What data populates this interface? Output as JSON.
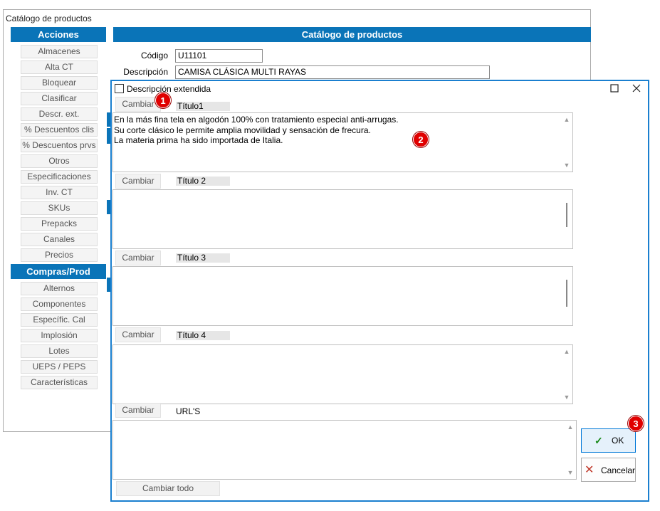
{
  "background_window": {
    "title": "Catálogo de productos",
    "acciones_header": "Acciones",
    "acciones": [
      "Almacenes",
      "Alta CT",
      "Bloquear",
      "Clasificar",
      "Descr. ext.",
      "% Descuentos clis",
      "% Descuentos prvs",
      "Otros",
      "Especificaciones",
      "Inv. CT",
      "SKUs",
      "Prepacks",
      "Canales",
      "Precios"
    ],
    "compras_header": "Compras/Prod",
    "compras": [
      "Alternos",
      "Componentes",
      "Específic. Cal",
      "Implosión",
      "Lotes",
      "UEPS / PEPS",
      "Características"
    ],
    "main_header": "Catálogo de productos",
    "codigo_label": "Código",
    "codigo_value": "U11101",
    "descripcion_label": "Descripción",
    "descripcion_value": "CAMISA CLÁSICA MULTI RAYAS"
  },
  "dialog": {
    "checkbox_label": "Descripción extendida",
    "maximize_icon": "maximize-icon",
    "close_icon": "close-icon",
    "sections": [
      {
        "button": "Cambiar",
        "title": "Título1",
        "text": "En la más fina tela en algodón 100% con tratamiento especial anti-arrugas.\nSu corte clásico le permite amplia movilidad y sensación de frecura.\nLa materia prima ha sido importada de Italia."
      },
      {
        "button": "Cambiar",
        "title": "Título 2",
        "text": ""
      },
      {
        "button": "Cambiar",
        "title": "Título 3",
        "text": ""
      },
      {
        "button": "Cambiar",
        "title": "Título 4",
        "text": ""
      },
      {
        "button": "Cambiar",
        "title": "URL'S",
        "text": ""
      }
    ],
    "cambiar_todo": "Cambiar todo",
    "ok_label": "OK",
    "cancel_label": "Cancelar"
  },
  "callouts": [
    "1",
    "2",
    "3"
  ],
  "colors": {
    "accent": "#0a74b8",
    "dialog_border": "#1a7fcf",
    "callout": "#e00000",
    "ok_check": "#1a8a1a",
    "cancel_x": "#c0392b"
  }
}
